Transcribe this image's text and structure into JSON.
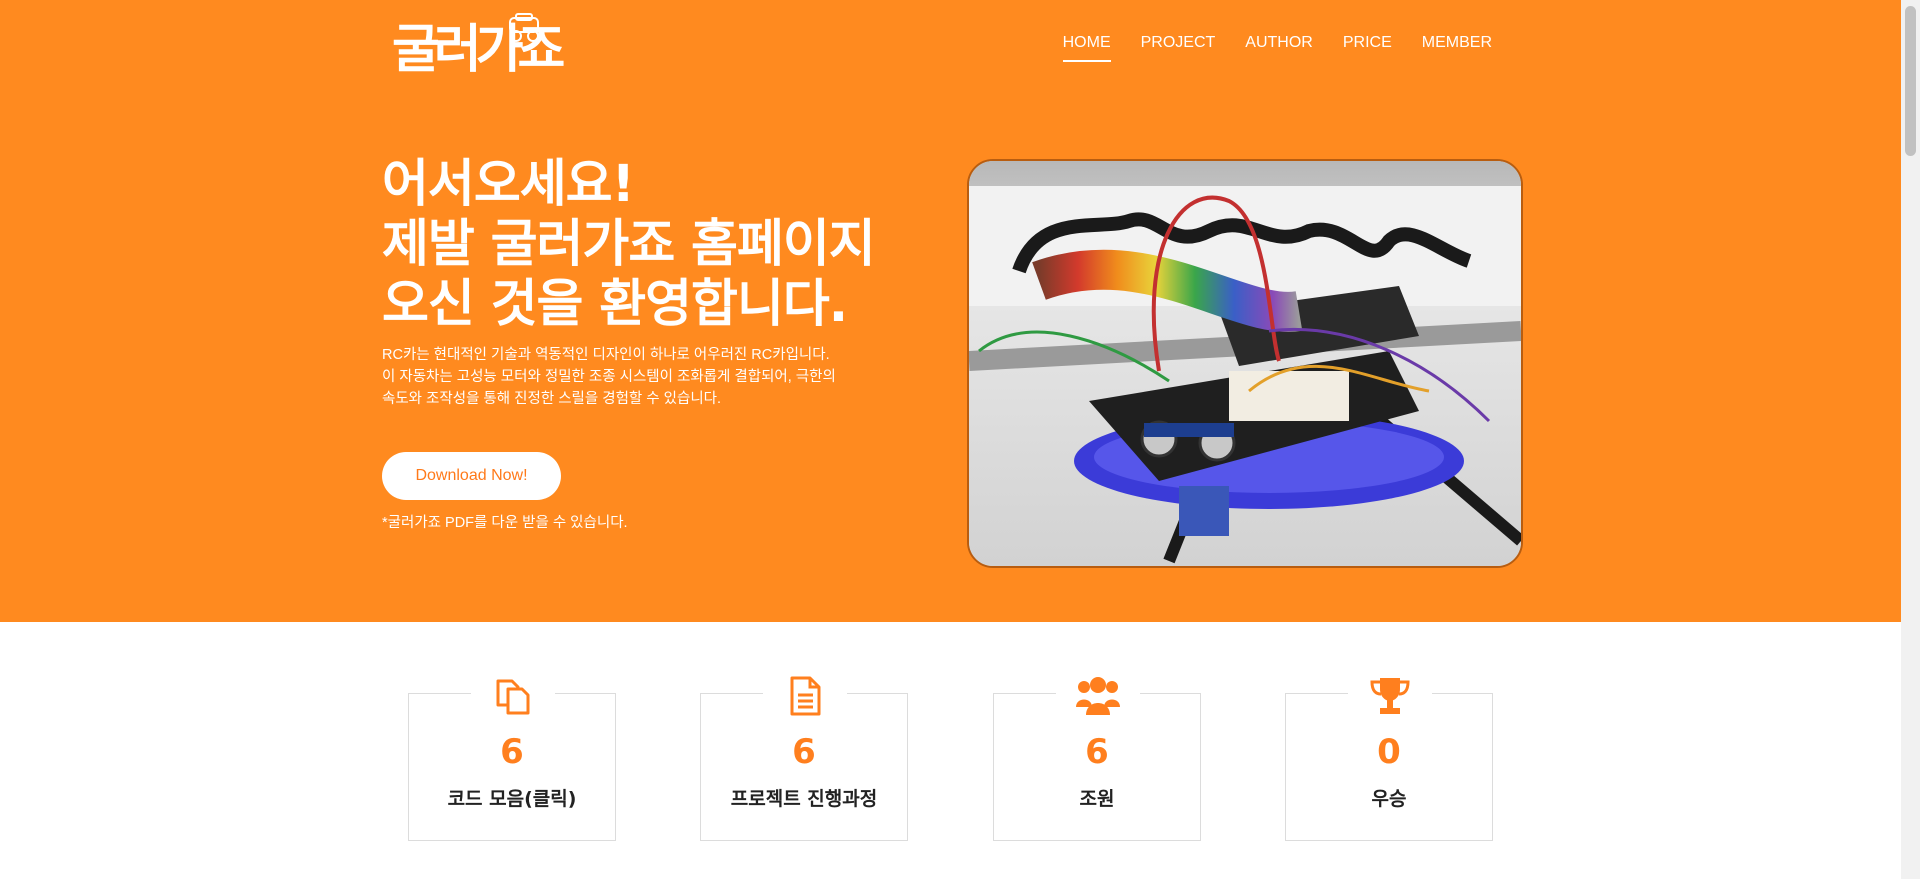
{
  "header": {
    "logo_text": "굴러가죠",
    "nav": [
      {
        "label": "HOME",
        "active": true
      },
      {
        "label": "PROJECT",
        "active": false
      },
      {
        "label": "AUTHOR",
        "active": false
      },
      {
        "label": "PRICE",
        "active": false
      },
      {
        "label": "MEMBER",
        "active": false
      }
    ]
  },
  "hero": {
    "headline": [
      "어서오세요!",
      "제발 굴러가죠 홈페이지",
      "오신 것을 환영합니다."
    ],
    "description": [
      "RC카는 현대적인 기술과 역동적인 디자인이 하나로 어우러진 RC카입니다.",
      "이 자동차는 고성능 모터와 정밀한 조종 시스템이 조화롭게 결합되어, 극한의",
      "속도와 조작성을 통해 진정한 스릴을 경험할 수 있습니다."
    ],
    "download_label": "Download Now!",
    "pdf_note": "*굴러가죠 PDF를 다운 받을 수 있습니다."
  },
  "stats": [
    {
      "icon": "files-icon",
      "value": "6",
      "label": "코드 모음(클릭)"
    },
    {
      "icon": "document-icon",
      "value": "6",
      "label": "프로젝트 진행과정"
    },
    {
      "icon": "users-icon",
      "value": "6",
      "label": "조원"
    },
    {
      "icon": "trophy-icon",
      "value": "0",
      "label": "우승"
    }
  ],
  "colors": {
    "accent": "#ff8a1f",
    "stat_number": "#ff7f1e",
    "white": "#ffffff"
  }
}
